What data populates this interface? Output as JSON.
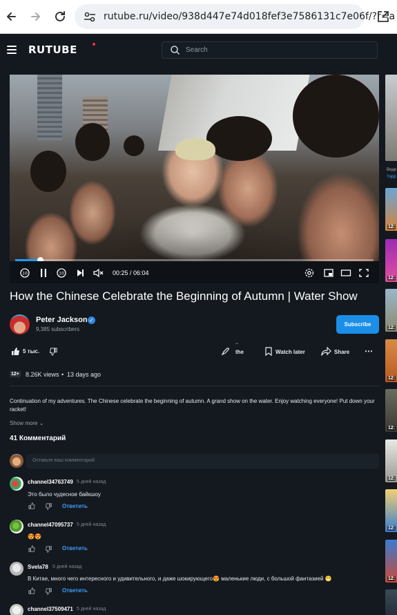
{
  "browser": {
    "url": "rutube.ru/video/938d447e74d018fef3e7586131c7e06f/?r=a"
  },
  "header": {
    "logo": "RUTUBE",
    "search_placeholder": "Search"
  },
  "player": {
    "time": "00:25 / 06:04",
    "progress": 0.069
  },
  "video": {
    "title": "How the Chinese Celebrate the Beginning of Autumn | Water Show",
    "author": "Peter Jackson",
    "subscribers": "9,385 subscribers",
    "subscribe_label": "Subscribe",
    "likes": "5 тыс.",
    "share_partial": "the",
    "watch_later": "Watch later",
    "share": "Share",
    "age_badge": "12+",
    "views": "8.26K views",
    "separator": "•",
    "date": "13 days ago",
    "description": "Continuation of my adventures. The Chinese celebrate the beginning of autumn. A grand show on the water. Enjoy watching everyone! Put down your racket!",
    "show_more": "Show more"
  },
  "comments": {
    "title": "41 Комментарий",
    "input_placeholder": "Оставьте ваш комментарий",
    "reply_label": "Ответить",
    "items": [
      {
        "name": "channel34763749",
        "date": "5 дней назад",
        "text": "Это было чудесное байкшоу"
      },
      {
        "name": "channel47095737",
        "date": "5 дней назад",
        "text": "😍😍"
      },
      {
        "name": "Svela78",
        "date": "5 дней назад",
        "text": "В Китае, много чего интересного и удивительного, и даже шокирующего😍 маленькие люди, с большой фантазией 😁"
      },
      {
        "name": "channel37509471",
        "date": "5 дней назад",
        "text": ""
      }
    ]
  },
  "rail": {
    "text1": "Виде",
    "text2": "Yapp",
    "durations": [
      "12:",
      "12:",
      "12:",
      "12:",
      "12:",
      "12:",
      "12:",
      "12:",
      "12:"
    ]
  }
}
